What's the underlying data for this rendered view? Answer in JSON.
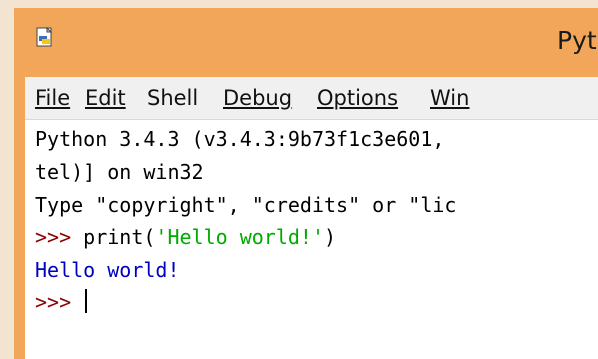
{
  "window": {
    "title": "Pyt"
  },
  "menu": {
    "file": "File",
    "edit": "Edit",
    "shell": "Shell",
    "debug": "Debug",
    "options": "Options",
    "windows": "Win"
  },
  "shell": {
    "banner_line1": "Python 3.4.3 (v3.4.3:9b73f1c3e601,",
    "banner_line2": "tel)] on win32",
    "banner_line3": "Type \"copyright\", \"credits\" or \"lic",
    "prompt1": ">>> ",
    "cmd_func_open": "print(",
    "cmd_string": "'Hello world!'",
    "cmd_close": ")",
    "output": "Hello world!",
    "prompt2": ">>> "
  },
  "colors": {
    "titlebar": "#f2a65a",
    "prompt": "#8b0000",
    "string": "#00aa00",
    "output": "#0000c0"
  },
  "icons": {
    "app": "python-idle-icon"
  }
}
